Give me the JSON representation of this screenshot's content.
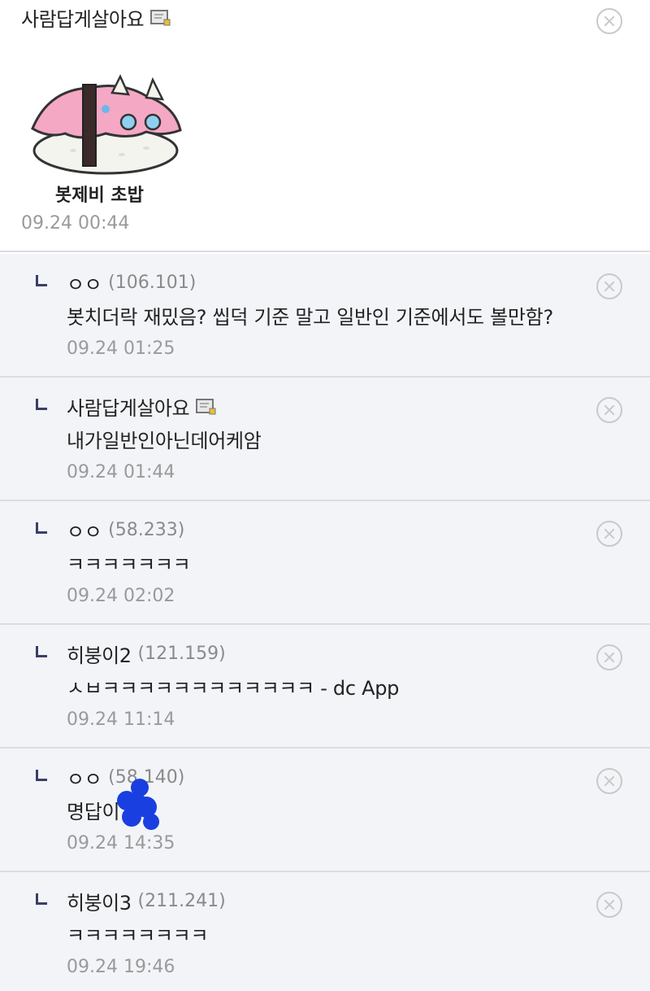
{
  "main_comment": {
    "nick": "사람답게살아요",
    "dccon_caption": "봇제비 초밥",
    "time": "09.24 00:44"
  },
  "replies": [
    {
      "nick": "ㅇㅇ",
      "ip": "(106.101)",
      "text": "봇치더락 재밌음? 씹덕 기준 말고 일반인 기준에서도 볼만함?",
      "time": "09.24 01:25"
    },
    {
      "nick": "사람답게살아요",
      "ip": "",
      "text": "내가일반인아닌데어케암",
      "time": "09.24 01:44"
    },
    {
      "nick": "ㅇㅇ",
      "ip": "(58.233)",
      "text": "ㅋㅋㅋㅋㅋㅋㅋ",
      "time": "09.24 02:02"
    },
    {
      "nick": "히붕이2",
      "ip": "(121.159)",
      "text": "ㅅㅂㅋㅋㅋㅋㅋㅋㅋㅋㅋㅋㅋㅋ - dc App",
      "time": "09.24 11:14"
    },
    {
      "nick": "ㅇㅇ",
      "ip": "(58.140)",
      "text": "명답이",
      "time": "09.24 14:35"
    },
    {
      "nick": "히붕이3",
      "ip": "(211.241)",
      "text": "ㅋㅋㅋㅋㅋㅋㅋㅋ",
      "time": "09.24 19:46"
    }
  ]
}
